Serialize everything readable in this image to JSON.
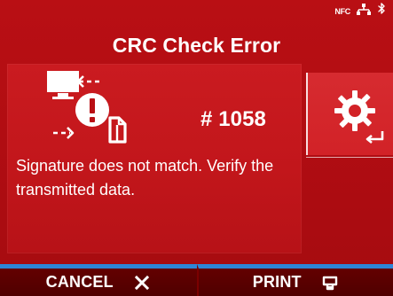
{
  "status_bar": {
    "nfc_label": "NFC",
    "network_icon": "network-icon",
    "bluetooth_icon": "bluetooth-icon"
  },
  "screen": {
    "title": "CRC Check Error",
    "error_code": "# 1058",
    "message": "Signature does not match. Verify the transmitted data."
  },
  "side_action": {
    "icon": "gear-icon",
    "accessory_icon": "enter-icon"
  },
  "soft_keys": {
    "cancel": {
      "label": "CANCEL",
      "icon": "close-icon"
    },
    "print": {
      "label": "PRINT",
      "icon": "print-icon"
    }
  },
  "colors": {
    "background": "#b10d12",
    "panel": "#c2161b",
    "side_button": "#d22227",
    "soft_key_background": "#5f0000",
    "soft_key_accent": "#2d86d7",
    "text": "#ffffff"
  }
}
